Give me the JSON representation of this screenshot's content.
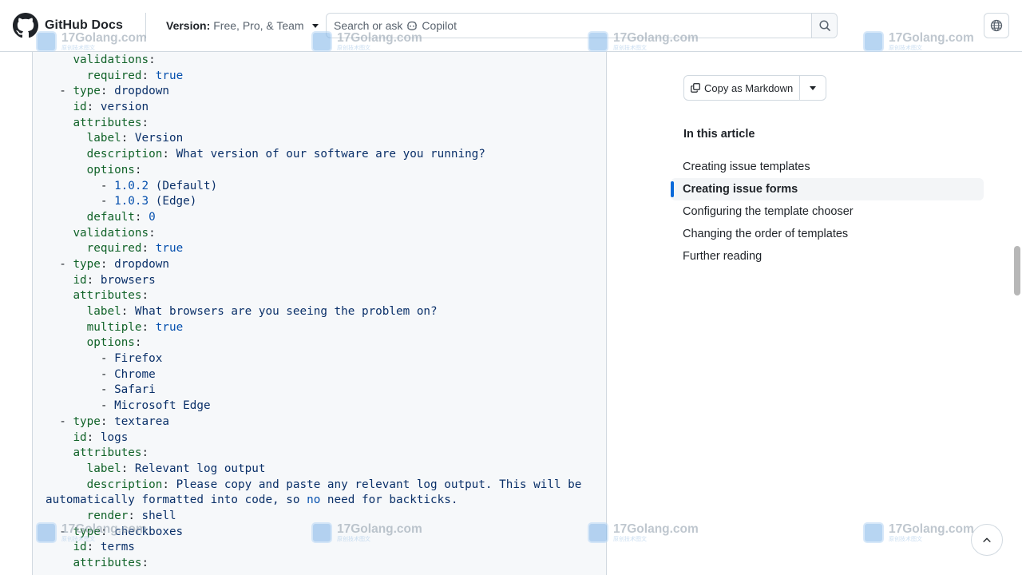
{
  "header": {
    "brand": "GitHub Docs",
    "version_label": "Version:",
    "version_value": "Free, Pro, & Team",
    "search_placeholder": "Search or ask",
    "search_copilot": "Copilot"
  },
  "code": {
    "lines": [
      [
        [
          "p",
          "    "
        ],
        [
          "k",
          "validations"
        ],
        [
          "p",
          ":"
        ]
      ],
      [
        [
          "p",
          "      "
        ],
        [
          "k",
          "required"
        ],
        [
          "p",
          ": "
        ],
        [
          "c",
          "true"
        ]
      ],
      [
        [
          "p",
          "  - "
        ],
        [
          "k",
          "type"
        ],
        [
          "p",
          ": "
        ],
        [
          "v",
          "dropdown"
        ]
      ],
      [
        [
          "p",
          "    "
        ],
        [
          "k",
          "id"
        ],
        [
          "p",
          ": "
        ],
        [
          "v",
          "version"
        ]
      ],
      [
        [
          "p",
          "    "
        ],
        [
          "k",
          "attributes"
        ],
        [
          "p",
          ":"
        ]
      ],
      [
        [
          "p",
          "      "
        ],
        [
          "k",
          "label"
        ],
        [
          "p",
          ": "
        ],
        [
          "v",
          "Version"
        ]
      ],
      [
        [
          "p",
          "      "
        ],
        [
          "k",
          "description"
        ],
        [
          "p",
          ": "
        ],
        [
          "v",
          "What version of our software are you running?"
        ]
      ],
      [
        [
          "p",
          "      "
        ],
        [
          "k",
          "options"
        ],
        [
          "p",
          ":"
        ]
      ],
      [
        [
          "p",
          "        - "
        ],
        [
          "c",
          "1.0.2"
        ],
        [
          "v",
          " (Default)"
        ]
      ],
      [
        [
          "p",
          "        - "
        ],
        [
          "c",
          "1.0.3"
        ],
        [
          "v",
          " (Edge)"
        ]
      ],
      [
        [
          "p",
          "      "
        ],
        [
          "k",
          "default"
        ],
        [
          "p",
          ": "
        ],
        [
          "c",
          "0"
        ]
      ],
      [
        [
          "p",
          "    "
        ],
        [
          "k",
          "validations"
        ],
        [
          "p",
          ":"
        ]
      ],
      [
        [
          "p",
          "      "
        ],
        [
          "k",
          "required"
        ],
        [
          "p",
          ": "
        ],
        [
          "c",
          "true"
        ]
      ],
      [
        [
          "p",
          "  - "
        ],
        [
          "k",
          "type"
        ],
        [
          "p",
          ": "
        ],
        [
          "v",
          "dropdown"
        ]
      ],
      [
        [
          "p",
          "    "
        ],
        [
          "k",
          "id"
        ],
        [
          "p",
          ": "
        ],
        [
          "v",
          "browsers"
        ]
      ],
      [
        [
          "p",
          "    "
        ],
        [
          "k",
          "attributes"
        ],
        [
          "p",
          ":"
        ]
      ],
      [
        [
          "p",
          "      "
        ],
        [
          "k",
          "label"
        ],
        [
          "p",
          ": "
        ],
        [
          "v",
          "What browsers are you seeing the problem on?"
        ]
      ],
      [
        [
          "p",
          "      "
        ],
        [
          "k",
          "multiple"
        ],
        [
          "p",
          ": "
        ],
        [
          "c",
          "true"
        ]
      ],
      [
        [
          "p",
          "      "
        ],
        [
          "k",
          "options"
        ],
        [
          "p",
          ":"
        ]
      ],
      [
        [
          "p",
          "        - "
        ],
        [
          "v",
          "Firefox"
        ]
      ],
      [
        [
          "p",
          "        - "
        ],
        [
          "v",
          "Chrome"
        ]
      ],
      [
        [
          "p",
          "        - "
        ],
        [
          "v",
          "Safari"
        ]
      ],
      [
        [
          "p",
          "        - "
        ],
        [
          "v",
          "Microsoft Edge"
        ]
      ],
      [
        [
          "p",
          "  - "
        ],
        [
          "k",
          "type"
        ],
        [
          "p",
          ": "
        ],
        [
          "v",
          "textarea"
        ]
      ],
      [
        [
          "p",
          "    "
        ],
        [
          "k",
          "id"
        ],
        [
          "p",
          ": "
        ],
        [
          "v",
          "logs"
        ]
      ],
      [
        [
          "p",
          "    "
        ],
        [
          "k",
          "attributes"
        ],
        [
          "p",
          ":"
        ]
      ],
      [
        [
          "p",
          "      "
        ],
        [
          "k",
          "label"
        ],
        [
          "p",
          ": "
        ],
        [
          "v",
          "Relevant log output"
        ]
      ],
      [
        [
          "p",
          "      "
        ],
        [
          "k",
          "description"
        ],
        [
          "p",
          ": "
        ],
        [
          "v",
          "Please copy and paste any relevant log output. This will be"
        ]
      ],
      [
        [
          "v",
          "automatically formatted into code, so "
        ],
        [
          "c",
          "no"
        ],
        [
          "v",
          " need for backticks."
        ]
      ],
      [
        [
          "p",
          "      "
        ],
        [
          "k",
          "render"
        ],
        [
          "p",
          ": "
        ],
        [
          "v",
          "shell"
        ]
      ],
      [
        [
          "p",
          "  - "
        ],
        [
          "k",
          "type"
        ],
        [
          "p",
          ": "
        ],
        [
          "v",
          "checkboxes"
        ]
      ],
      [
        [
          "p",
          "    "
        ],
        [
          "k",
          "id"
        ],
        [
          "p",
          ": "
        ],
        [
          "v",
          "terms"
        ]
      ],
      [
        [
          "p",
          "    "
        ],
        [
          "k",
          "attributes"
        ],
        [
          "p",
          ":"
        ]
      ]
    ]
  },
  "sidebar": {
    "copy_label": "Copy as Markdown",
    "toc_heading": "In this article",
    "toc_items": [
      {
        "label": "Creating issue templates",
        "active": false
      },
      {
        "label": "Creating issue forms",
        "active": true
      },
      {
        "label": "Configuring the template chooser",
        "active": false
      },
      {
        "label": "Changing the order of templates",
        "active": false
      },
      {
        "label": "Further reading",
        "active": false
      }
    ]
  },
  "watermark": {
    "text": "17Golang.com",
    "sub": "原创技术图文"
  },
  "colors": {
    "accent": "#0969da",
    "key": "#116329",
    "string": "#0a3069",
    "constant": "#0550ae"
  },
  "icons": {
    "logo": "github-mark-icon",
    "search": "search-icon",
    "globe": "globe-icon",
    "copy": "copy-icon",
    "top": "chevron-up-icon"
  }
}
